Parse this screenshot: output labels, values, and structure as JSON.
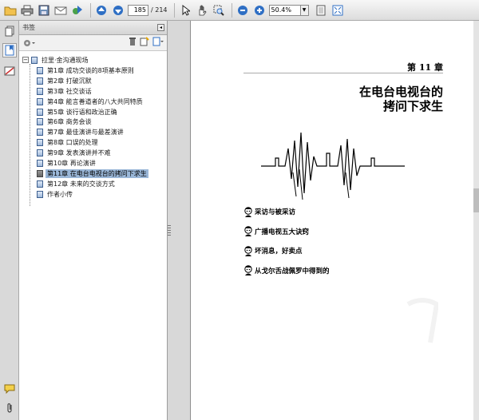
{
  "toolbar": {
    "page_current": "185",
    "page_total": "/ 214",
    "zoom": "50.4%",
    "icons": [
      "open-folder-icon",
      "print-icon",
      "save-icon",
      "email-icon",
      "collaborate-icon",
      "previous-page-icon",
      "next-page-icon",
      "select-text-icon",
      "hand-icon",
      "zoom-marquee-icon",
      "zoom-out-icon",
      "zoom-in-icon",
      "single-page-icon",
      "fit-page-icon"
    ]
  },
  "rail": {
    "icons": [
      "pages-icon",
      "bookmarks-icon",
      "signatures-icon",
      "comments-icon",
      "attachments-icon"
    ]
  },
  "bookmarks": {
    "panel_title": "书签",
    "root_label": "拉里·金沟通现场",
    "items": [
      {
        "label": "第1章   成功交谈的8项基本原则"
      },
      {
        "label": "第2章   打破沉默"
      },
      {
        "label": "第3章   社交谈话"
      },
      {
        "label": "第4章   能言善道者的八大共同特质"
      },
      {
        "label": "第5章   谈行语和政治正确"
      },
      {
        "label": "第6章   商务会谈"
      },
      {
        "label": "第7章   最佳演讲与最差演讲"
      },
      {
        "label": "第8章   口误的处理"
      },
      {
        "label": "第9章   发表演讲并不难"
      },
      {
        "label": "第10章    再论演讲"
      },
      {
        "label": "第11章    在电台电视台的拷问下求生"
      },
      {
        "label": "第12章    未来的交谈方式"
      },
      {
        "label": "作者小传"
      }
    ],
    "selected_index": 10
  },
  "document": {
    "chapter_no": "第 11 章",
    "title_line1": "在电台电视台的",
    "title_line2": "拷问下求生",
    "sections": [
      {
        "label": "采访与被采访"
      },
      {
        "label": "广播电视五大诀窍"
      },
      {
        "label": "坏消息，好卖点"
      },
      {
        "label": "从戈尔舌战佩罗中得到的"
      }
    ]
  },
  "colors": {
    "selection": "#9ab7d8",
    "toolbar_blue": "#2f6fc4"
  }
}
